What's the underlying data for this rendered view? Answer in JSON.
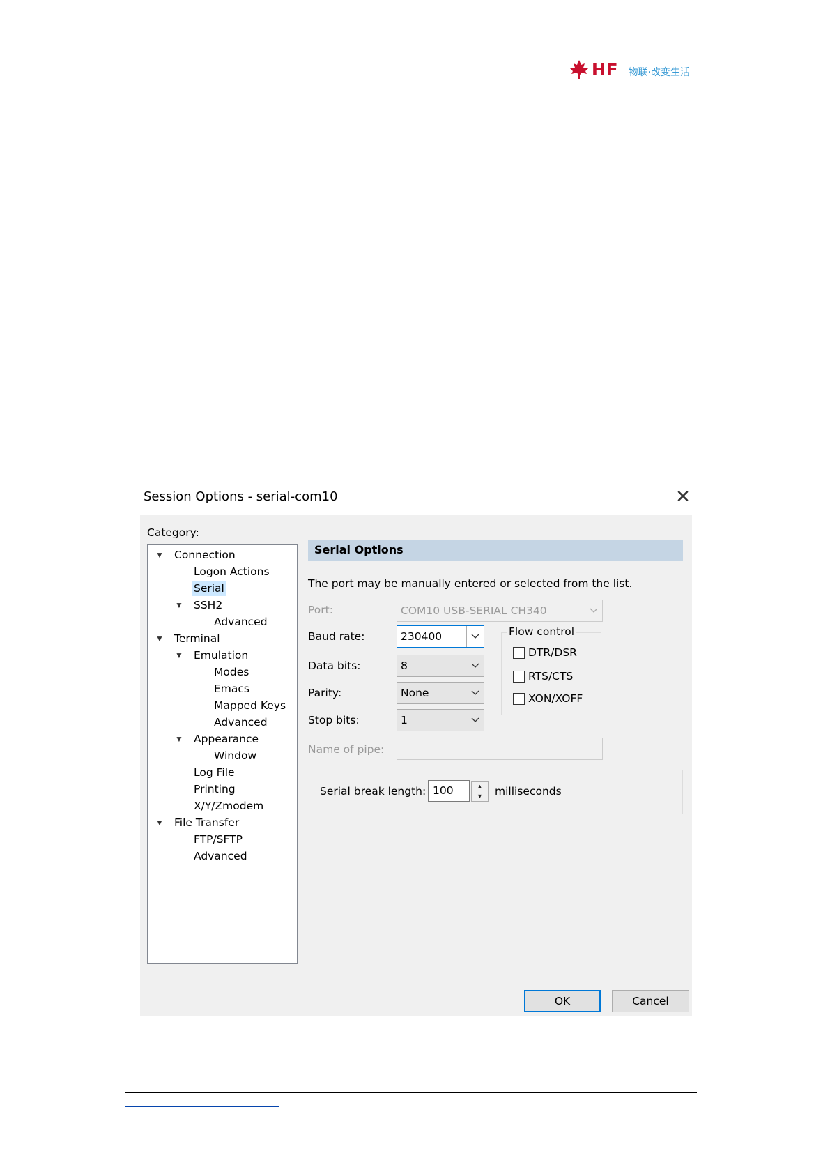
{
  "header": {
    "logo_text": "HF",
    "slogan": "物联·改变生活"
  },
  "dialog": {
    "title": "Session Options - serial-com10",
    "category_label": "Category:",
    "tree": [
      {
        "label": "Connection",
        "level": 0,
        "expanded": true
      },
      {
        "label": "Logon Actions",
        "level": 1
      },
      {
        "label": "Serial",
        "level": 1,
        "selected": true
      },
      {
        "label": "SSH2",
        "level": 1,
        "expanded": true
      },
      {
        "label": "Advanced",
        "level": 2
      },
      {
        "label": "Terminal",
        "level": 0,
        "expanded": true
      },
      {
        "label": "Emulation",
        "level": 1,
        "expanded": true
      },
      {
        "label": "Modes",
        "level": 2
      },
      {
        "label": "Emacs",
        "level": 2
      },
      {
        "label": "Mapped Keys",
        "level": 2
      },
      {
        "label": "Advanced",
        "level": 2
      },
      {
        "label": "Appearance",
        "level": 1,
        "expanded": true
      },
      {
        "label": "Window",
        "level": 2
      },
      {
        "label": "Log File",
        "level": 1
      },
      {
        "label": "Printing",
        "level": 1
      },
      {
        "label": "X/Y/Zmodem",
        "level": 1
      },
      {
        "label": "File Transfer",
        "level": 0,
        "expanded": true
      },
      {
        "label": "FTP/SFTP",
        "level": 1
      },
      {
        "label": "Advanced",
        "level": 1
      }
    ],
    "section_title": "Serial Options",
    "description": "The port may be manually entered or selected from the list.",
    "port": {
      "label": "Port:",
      "value": "COM10 USB-SERIAL CH340"
    },
    "baud_rate": {
      "label": "Baud rate:",
      "value": "230400"
    },
    "data_bits": {
      "label": "Data bits:",
      "value": "8"
    },
    "parity": {
      "label": "Parity:",
      "value": "None"
    },
    "stop_bits": {
      "label": "Stop bits:",
      "value": "1"
    },
    "pipe": {
      "label": "Name of pipe:",
      "value": ""
    },
    "flow_control": {
      "label": "Flow control",
      "options": [
        {
          "label": "DTR/DSR",
          "checked": false
        },
        {
          "label": "RTS/CTS",
          "checked": false
        },
        {
          "label": "XON/XOFF",
          "checked": false
        }
      ]
    },
    "serial_break": {
      "label": "Serial break length:",
      "value": "100",
      "unit": "milliseconds"
    },
    "ok_label": "OK",
    "cancel_label": "Cancel",
    "colors": {
      "accent": "#0078d7",
      "section_header": "#c5d5e4",
      "selection": "#cce8ff"
    }
  }
}
